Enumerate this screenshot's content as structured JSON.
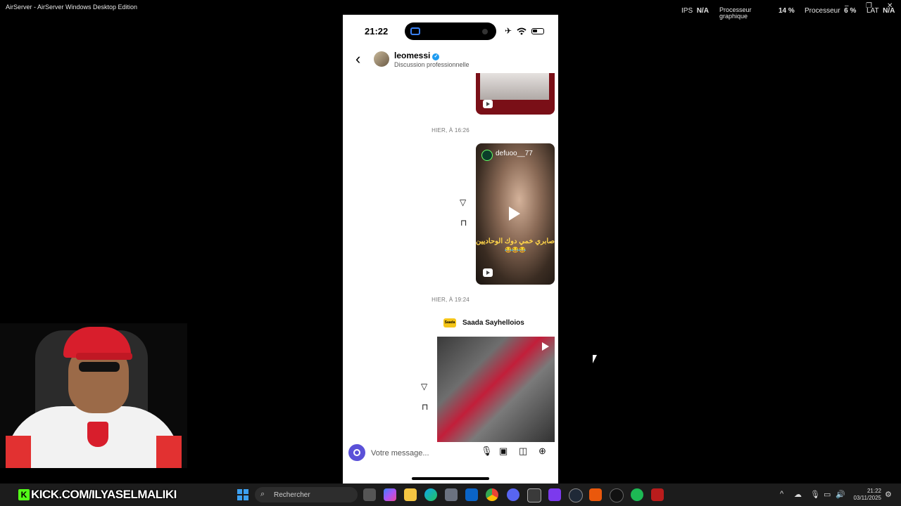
{
  "window": {
    "title": "AirServer - AirServer Windows Desktop Edition",
    "controls": [
      "–",
      "❐",
      "✕"
    ]
  },
  "perf": {
    "ips_label": "IPS",
    "ips_value": "N/A",
    "gpu_label_1": "Processeur",
    "gpu_label_2": "graphique",
    "gpu_value": "14 %",
    "cpu_label": "Processeur",
    "cpu_value": "6 %",
    "lat_label": "LAT",
    "lat_value": "N/A"
  },
  "phone": {
    "time": "21:22",
    "status_icons": [
      "airplane-icon",
      "wifi-icon",
      "battery-icon"
    ],
    "header": {
      "back_icon": "chevron-left-icon",
      "username": "leomessi",
      "subtitle": "Discussion professionnelle"
    },
    "messages": {
      "timestamp_1": "HIER, À 16:26",
      "reel_author": "defuoo__77",
      "reel_caption": "صابري خمي دوك الوحاديين",
      "reel_emojis": "😂😂😂",
      "timestamp_2": "HIER, À 19:24",
      "post_author_badge": "Saada",
      "post_author": "Saada Sayhelloios"
    },
    "composer": {
      "placeholder": "Votre message...",
      "icons": [
        "mic-icon",
        "image-icon",
        "sticker-icon",
        "plus-icon"
      ]
    }
  },
  "overlay": {
    "kick_logo": "K",
    "kick_text": "KICK.COM/ILYASELMALIKI"
  },
  "taskbar": {
    "search_label": "Rechercher",
    "apps": [
      "task-view",
      "copilot",
      "file-explorer",
      "edge",
      "store",
      "outlook",
      "chrome",
      "discord",
      "app-window",
      "game-app",
      "steam",
      "firefox-like",
      "app",
      "spotify",
      "stream-app"
    ],
    "clock_time": "21:22",
    "clock_date": "03/11/2025"
  },
  "colors": {
    "accent_blue": "#1d9bf0",
    "camera_button": "#5b51d8",
    "kick_green": "#53fc18",
    "reel_dark_red": "#7a0f17"
  }
}
